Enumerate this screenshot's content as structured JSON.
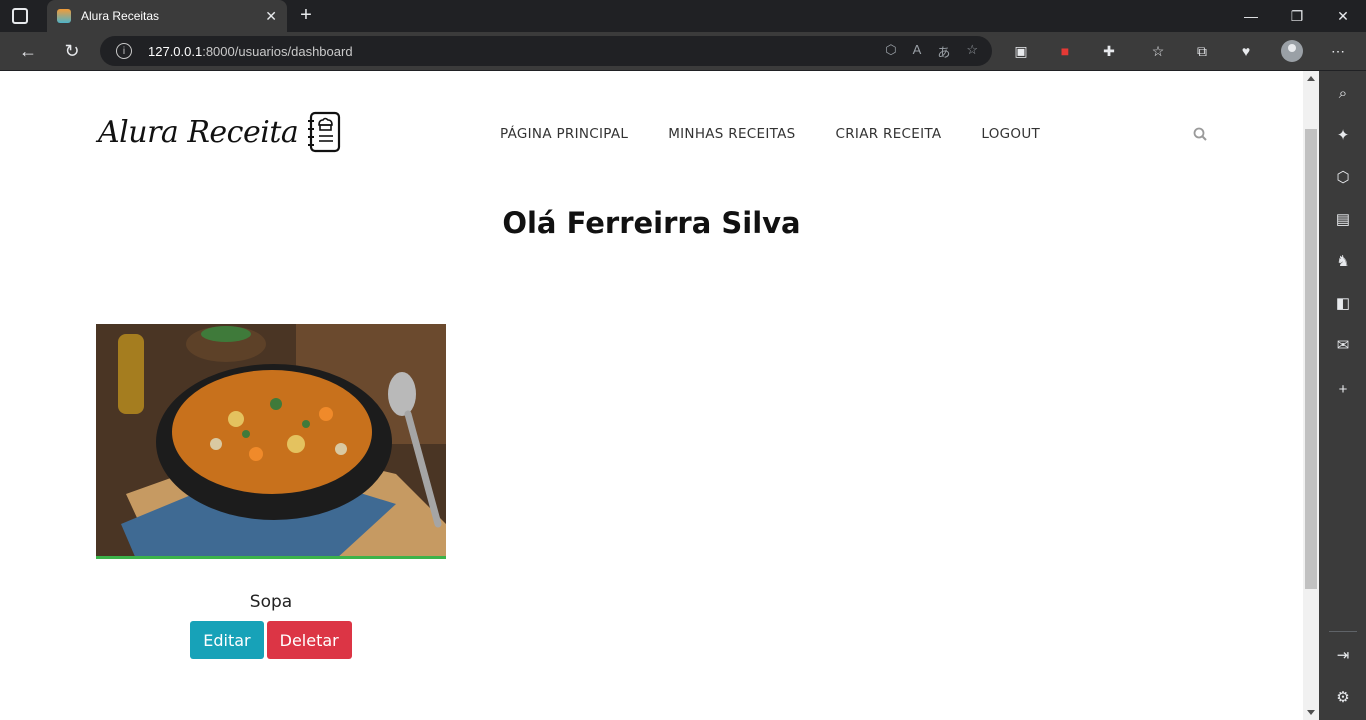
{
  "browser": {
    "tab_title": "Alura Receitas",
    "url_host": "127.0.0.1",
    "url_rest": ":8000/usuarios/dashboard"
  },
  "site": {
    "logo_text": "Alura Receita",
    "nav": [
      "PÁGINA PRINCIPAL",
      "MINHAS RECEITAS",
      "CRIAR RECEITA",
      "LOGOUT"
    ]
  },
  "dashboard": {
    "greeting": "Olá Ferreirra Silva",
    "recipes": [
      {
        "title": "Sopa",
        "edit_label": "Editar",
        "delete_label": "Deletar"
      }
    ]
  },
  "colors": {
    "edit": "#17a2b8",
    "delete": "#dc3545",
    "accent_border": "#3cb34a"
  }
}
